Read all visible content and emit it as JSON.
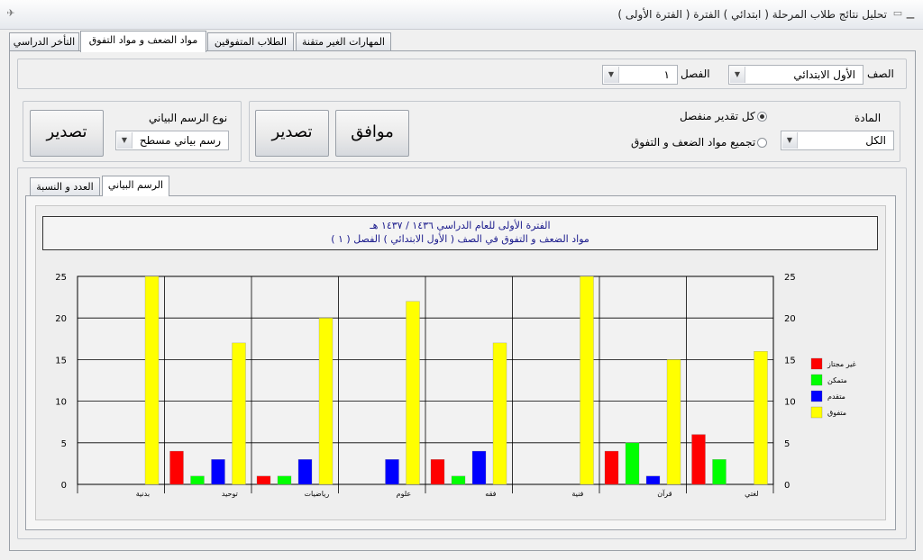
{
  "window": {
    "title": "تحليل نتائج طلاب المرحلة ( ابتدائي ) الفترة ( الفترة الأولى )"
  },
  "tabs": [
    {
      "label": "المهارات الغير متقنة",
      "active": false
    },
    {
      "label": "الطلاب المتفوقين",
      "active": false
    },
    {
      "label": "مواد الضعف و مواد التفوق",
      "active": true
    },
    {
      "label": "التأخر الدراسي",
      "active": false
    }
  ],
  "filters": {
    "grade_label": "الصف",
    "grade_value": "الأول الابتدائي",
    "class_label": "الفصل",
    "class_value": "١"
  },
  "options": {
    "subject_label": "المادة",
    "subject_value": "الكل",
    "radio_separate": "كل تقدير منفصل",
    "radio_grouped": "تجميع مواد الضعف و التفوق",
    "ok_button": "موافق",
    "export_button": "تصدير",
    "chart_type_label": "نوع الرسم البياني",
    "chart_type_value": "رسم بياني مسطح",
    "export_button_2": "تصدير"
  },
  "subtabs": [
    {
      "label": "الرسم البياني",
      "active": true
    },
    {
      "label": "العدد و النسبة",
      "active": false
    }
  ],
  "chart_data": {
    "type": "bar",
    "title": "الفترة الأولى للعام الدراسي ١٤٣٦ / ١٤٣٧ هـ",
    "subtitle": "مواد الضعف و التفوق في الصف ( الأول الابتدائي ) الفصل ( ١ )",
    "categories": [
      "بدنية",
      "توحيد",
      "رياضيات",
      "علوم",
      "فقه",
      "فنية",
      "قرآن",
      "لغتي"
    ],
    "series": [
      {
        "name": "غير مجتاز",
        "color": "#ff0000",
        "values": [
          0,
          4,
          1,
          0,
          3,
          0,
          4,
          6
        ]
      },
      {
        "name": "متمكن",
        "color": "#00ff00",
        "values": [
          0,
          1,
          1,
          0,
          1,
          0,
          5,
          3
        ]
      },
      {
        "name": "متقدم",
        "color": "#0000ff",
        "values": [
          0,
          3,
          3,
          3,
          4,
          0,
          1,
          0
        ]
      },
      {
        "name": "متفوق",
        "color": "#ffff00",
        "values": [
          25,
          17,
          20,
          22,
          17,
          25,
          15,
          16
        ]
      }
    ],
    "yticks": [
      "0",
      "5",
      "10",
      "15",
      "20",
      "25"
    ],
    "ylim": [
      0,
      25
    ],
    "grid": true,
    "legend": "right"
  }
}
